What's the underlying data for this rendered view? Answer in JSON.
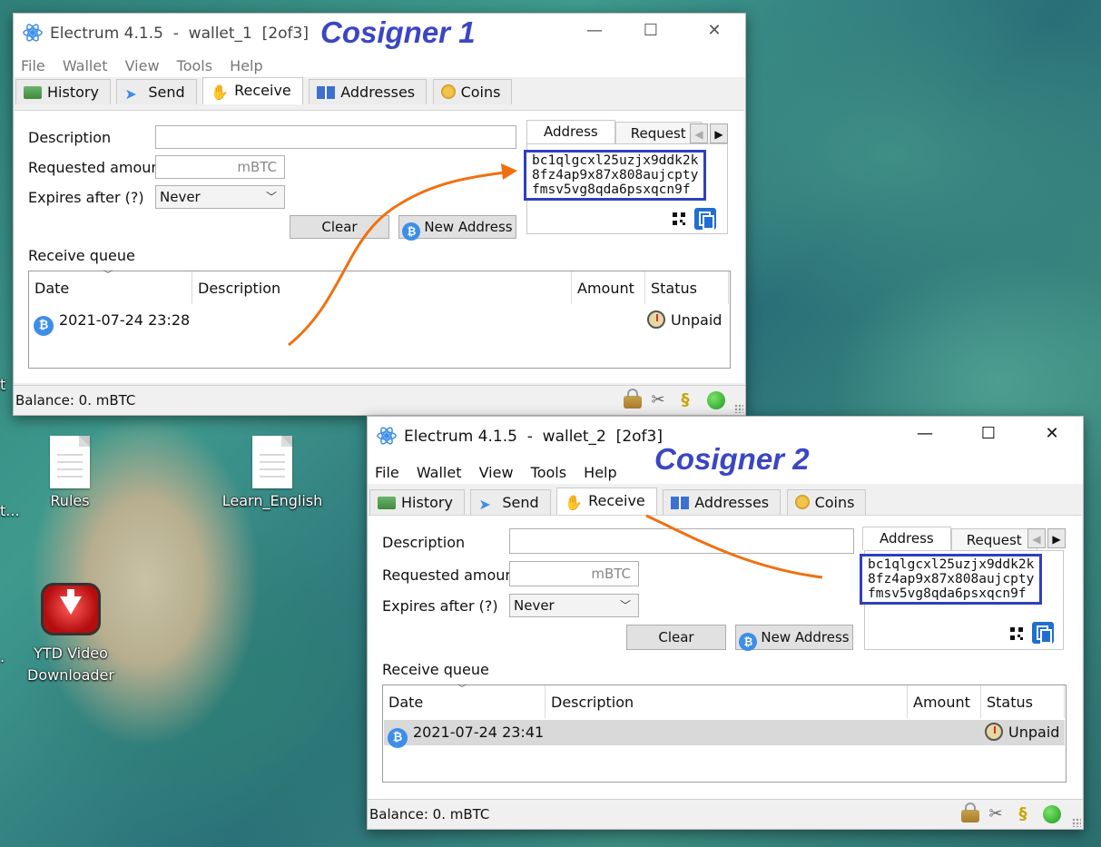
{
  "desktop": {
    "icons": [
      {
        "label": "Rules"
      },
      {
        "label": "Learn_English"
      },
      {
        "label": "YTD Video\nDownloader"
      }
    ],
    "edge_fragments": [
      "t",
      "t...",
      "."
    ]
  },
  "windows": [
    {
      "title": "Electrum 4.1.5  -  wallet_1  [2of3]",
      "annotation": "Cosigner 1",
      "menu": [
        "File",
        "Wallet",
        "View",
        "Tools",
        "Help"
      ],
      "tabs": [
        "History",
        "Send",
        "Receive",
        "Addresses",
        "Coins"
      ],
      "active_tab": "Receive",
      "form": {
        "description_label": "Description",
        "description_value": "",
        "amount_label": "Requested amount",
        "amount_unit": "mBTC",
        "expires_label": "Expires after (?)",
        "expires_value": "Never",
        "clear_button": "Clear",
        "new_address_button": "New Address"
      },
      "right_tabs": [
        "Address",
        "Request"
      ],
      "address_lines": [
        "bc1qlgcxl25uzjx9ddk2k",
        "8fz4ap9x87x808aujcpty",
        "fmsv5vg8qda6psxqcn9f"
      ],
      "queue_label": "Receive queue",
      "queue_columns": [
        "Date",
        "Description",
        "Amount",
        "Status"
      ],
      "queue_rows": [
        {
          "date": "2021-07-24 23:28",
          "description": "",
          "amount": "",
          "status": "Unpaid"
        }
      ],
      "balance": "Balance: 0. mBTC",
      "window_controls": [
        "—",
        "☐",
        "✕"
      ]
    },
    {
      "title": "Electrum 4.1.5  -  wallet_2  [2of3]",
      "annotation": "Cosigner 2",
      "menu": [
        "File",
        "Wallet",
        "View",
        "Tools",
        "Help"
      ],
      "tabs": [
        "History",
        "Send",
        "Receive",
        "Addresses",
        "Coins"
      ],
      "active_tab": "Receive",
      "form": {
        "description_label": "Description",
        "description_value": "",
        "amount_label": "Requested amount",
        "amount_unit": "mBTC",
        "expires_label": "Expires after (?)",
        "expires_value": "Never",
        "clear_button": "Clear",
        "new_address_button": "New Address"
      },
      "right_tabs": [
        "Address",
        "Request"
      ],
      "address_lines": [
        "bc1qlgcxl25uzjx9ddk2k",
        "8fz4ap9x87x808aujcpty",
        "fmsv5vg8qda6psxqcn9f"
      ],
      "queue_label": "Receive queue",
      "queue_columns": [
        "Date",
        "Description",
        "Amount",
        "Status"
      ],
      "queue_rows": [
        {
          "date": "2021-07-24 23:41",
          "description": "",
          "amount": "",
          "status": "Unpaid"
        }
      ],
      "balance": "Balance: 0. mBTC",
      "window_controls": [
        "—",
        "☐",
        "✕"
      ]
    }
  ],
  "colors": {
    "annotation_text": "#3b46c4",
    "address_highlight_border": "#2f3fbf",
    "annotation_arrow": "#f07010",
    "bitcoin_icon": "#3d8ee8"
  }
}
